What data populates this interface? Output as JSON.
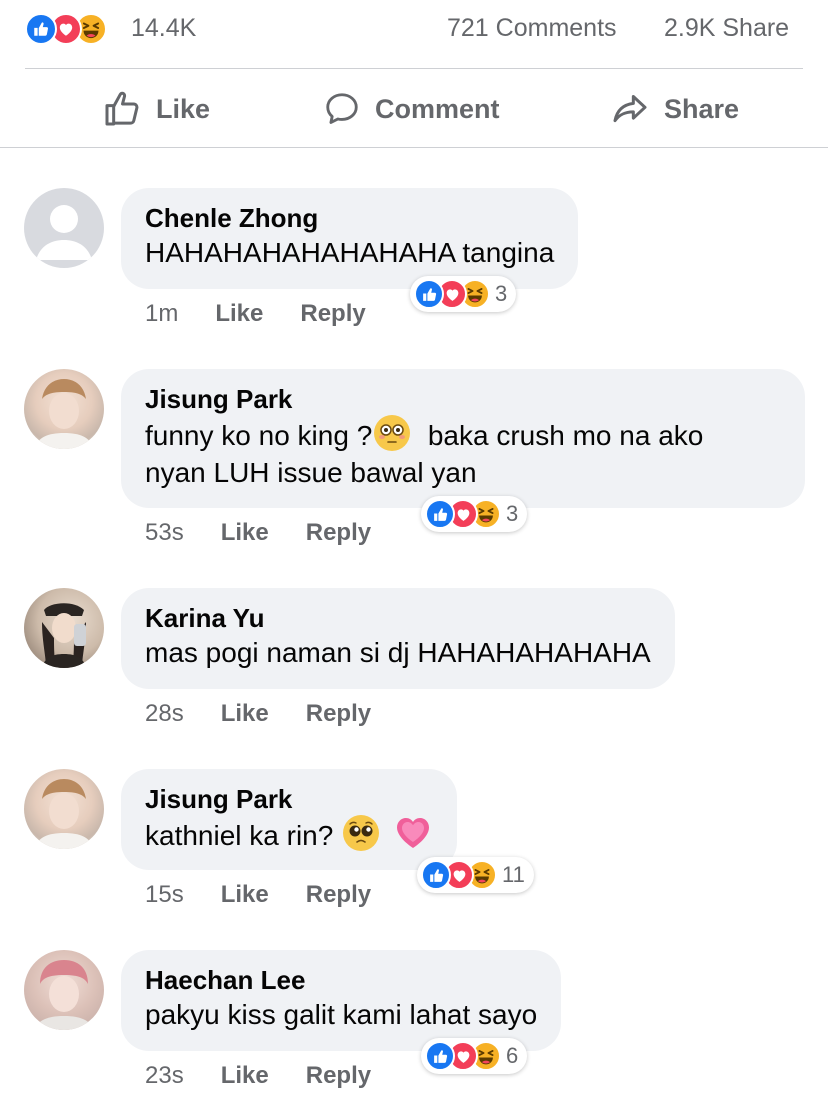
{
  "post_summary": {
    "reaction_icons": [
      "like-icon",
      "love-icon",
      "haha-icon"
    ],
    "reaction_count": "14.4K",
    "comments_count": "721 Comments",
    "shares_count": "2.9K Share"
  },
  "actions": {
    "like_label": "Like",
    "comment_label": "Comment",
    "share_label": "Share"
  },
  "colors": {
    "like": "#1877f2",
    "love": "#f33e58",
    "haha": "#f7b125",
    "bubble": "#f0f2f5",
    "muted_text": "#65676b"
  },
  "comments": [
    {
      "author": "Chenle Zhong",
      "text_lines": [
        "HAHAHAHAHAHAHAHA tangina"
      ],
      "time": "1m",
      "like_label": "Like",
      "reply_label": "Reply",
      "reactions": [
        "like-icon",
        "love-icon",
        "haha-icon"
      ],
      "reaction_count": "3",
      "avatar": "default-avatar"
    },
    {
      "author": "Jisung Park",
      "text_lines": [
        "funny ko no king ?",
        "baka crush mo na ako",
        "nyan LUH issue bawal yan"
      ],
      "time": "53s",
      "like_label": "Like",
      "reply_label": "Reply",
      "reactions": [
        "like-icon",
        "love-icon",
        "haha-icon"
      ],
      "reaction_count": "3",
      "inline_emoji": "flushed-face-icon"
    },
    {
      "author": "Karina Yu",
      "text_lines": [
        "mas pogi naman si dj HAHAHAHAHAHA"
      ],
      "time": "28s",
      "like_label": "Like",
      "reply_label": "Reply"
    },
    {
      "author": "Jisung Park",
      "text_lines": [
        "kathniel ka rin?"
      ],
      "time": "15s",
      "like_label": "Like",
      "reply_label": "Reply",
      "reactions": [
        "like-icon",
        "love-icon",
        "haha-icon"
      ],
      "reaction_count": "11",
      "inline_emoji": [
        "pleading-face-icon",
        "growing-heart-icon"
      ]
    },
    {
      "author": "Haechan Lee",
      "text_lines": [
        "pakyu kiss galit kami lahat sayo"
      ],
      "time": "23s",
      "like_label": "Like",
      "reply_label": "Reply",
      "reactions": [
        "like-icon",
        "love-icon",
        "haha-icon"
      ],
      "reaction_count": "6"
    }
  ]
}
